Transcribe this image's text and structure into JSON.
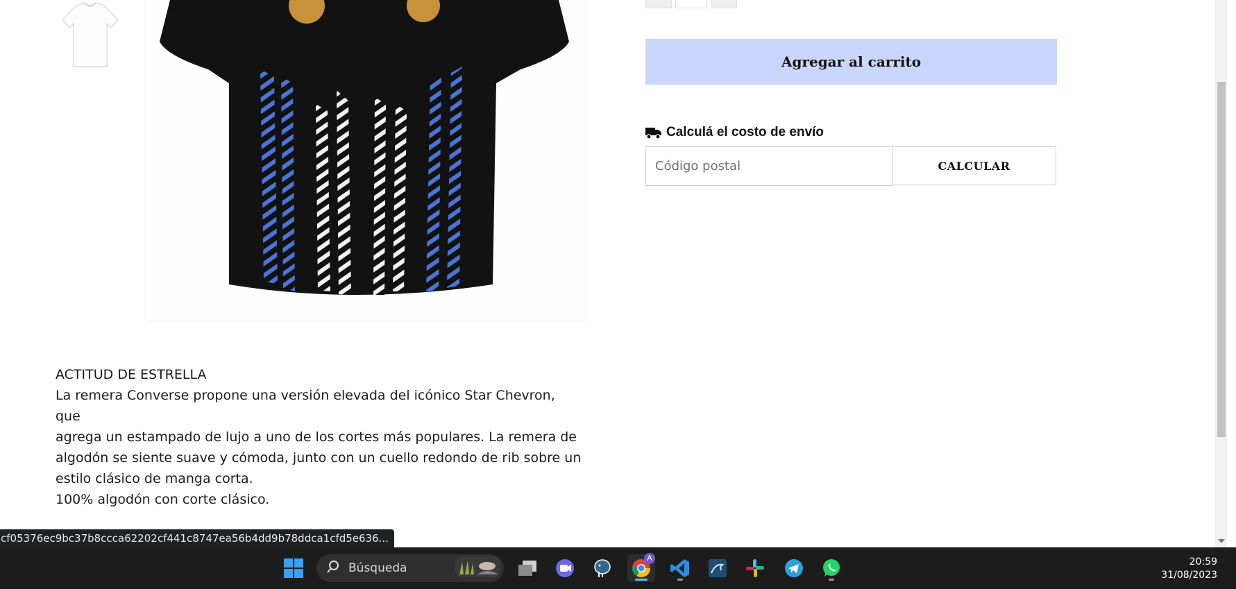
{
  "product": {
    "add_to_cart_label": "Agregar al carrito",
    "shipping": {
      "title": "Calculá el costo de envío",
      "postal_placeholder": "Código postal",
      "calculate_label": "CALCULAR"
    },
    "description": {
      "heading": "ACTITUD DE ESTRELLA",
      "lines": [
        "La remera Converse propone una versión elevada del icónico Star Chevron, que",
        "agrega un estampado de lujo a uno de los cortes más populares. La remera de",
        "algodón se siente suave y cómoda, junto con un cuello redondo de rib sobre un",
        "estilo clásico de manga corta.",
        "100% algodón con corte clásico."
      ]
    }
  },
  "status_bar": {
    "url": "cf05376ec9bc37b8ccca62202cf441c8747ea56b4dd9b78ddca1cfd5e636..."
  },
  "taskbar": {
    "search_label": "Búsqueda",
    "apps": [
      "windows-start-icon",
      "task-view-icon",
      "teams-meet-icon",
      "postgresql-icon",
      "chrome-icon",
      "vscode-icon",
      "mysql-workbench-icon",
      "slack-icon",
      "telegram-icon",
      "whatsapp-icon"
    ],
    "chrome_badge": "A",
    "clock_time": "20:59",
    "clock_date": "31/08/2023"
  },
  "colors": {
    "add_to_cart_bg": "#cad6fd",
    "taskbar_bg": "#1c1c1c",
    "accent_indicator": "#4cc2ff"
  }
}
